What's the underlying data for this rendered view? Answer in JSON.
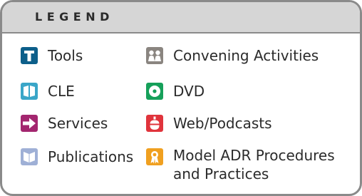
{
  "legend": {
    "title": "LEGEND",
    "items": [
      {
        "label": "Tools",
        "icon": "tools-icon",
        "color": "#0d5f8a"
      },
      {
        "label": "CLE",
        "icon": "cle-icon",
        "color": "#3aa6c8"
      },
      {
        "label": "Services",
        "icon": "services-icon",
        "color": "#a3266f"
      },
      {
        "label": "Publications",
        "icon": "publications-icon",
        "color": "#9fb0d6"
      },
      {
        "label": "Convening Activities",
        "icon": "convening-activities-icon",
        "color": "#8a8580"
      },
      {
        "label": "DVD",
        "icon": "dvd-icon",
        "color": "#16a05a"
      },
      {
        "label": "Web/Podcasts",
        "icon": "web-podcasts-icon",
        "color": "#e0343c"
      },
      {
        "label": "Model ADR Procedures and Practices",
        "icon": "model-adr-icon",
        "color": "#f0a020"
      }
    ]
  }
}
